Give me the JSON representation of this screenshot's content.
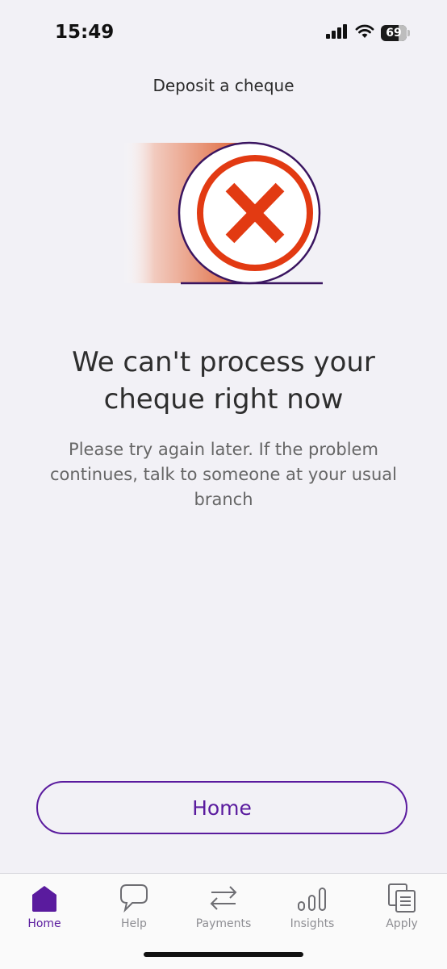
{
  "status_bar": {
    "time": "15:49",
    "battery": "69",
    "battery_level": 0.69,
    "icons": [
      "signal-icon",
      "wifi-icon",
      "battery-icon"
    ]
  },
  "screen": {
    "title": "Deposit a cheque",
    "headline": "We can't process your cheque right now",
    "message": "Please try again later. If the problem continues, talk to someone at your usual branch",
    "illustration_icon": "error-x-icon"
  },
  "actions": {
    "home_button_label": "Home"
  },
  "tab_bar": {
    "items": [
      {
        "label": "Home",
        "icon": "home-icon",
        "active": true
      },
      {
        "label": "Help",
        "icon": "chat-bubble-icon",
        "active": false
      },
      {
        "label": "Payments",
        "icon": "transfer-arrows-icon",
        "active": false
      },
      {
        "label": "Insights",
        "icon": "insights-icon",
        "active": false
      },
      {
        "label": "Apply",
        "icon": "documents-icon",
        "active": false
      }
    ]
  },
  "colors": {
    "background": "#f2f1f6",
    "accent": "#5a1b9e",
    "error_red": "#e23a12",
    "text_dark": "#2e2e2e",
    "text_muted": "#666666",
    "tab_inactive": "#8e8e93"
  }
}
